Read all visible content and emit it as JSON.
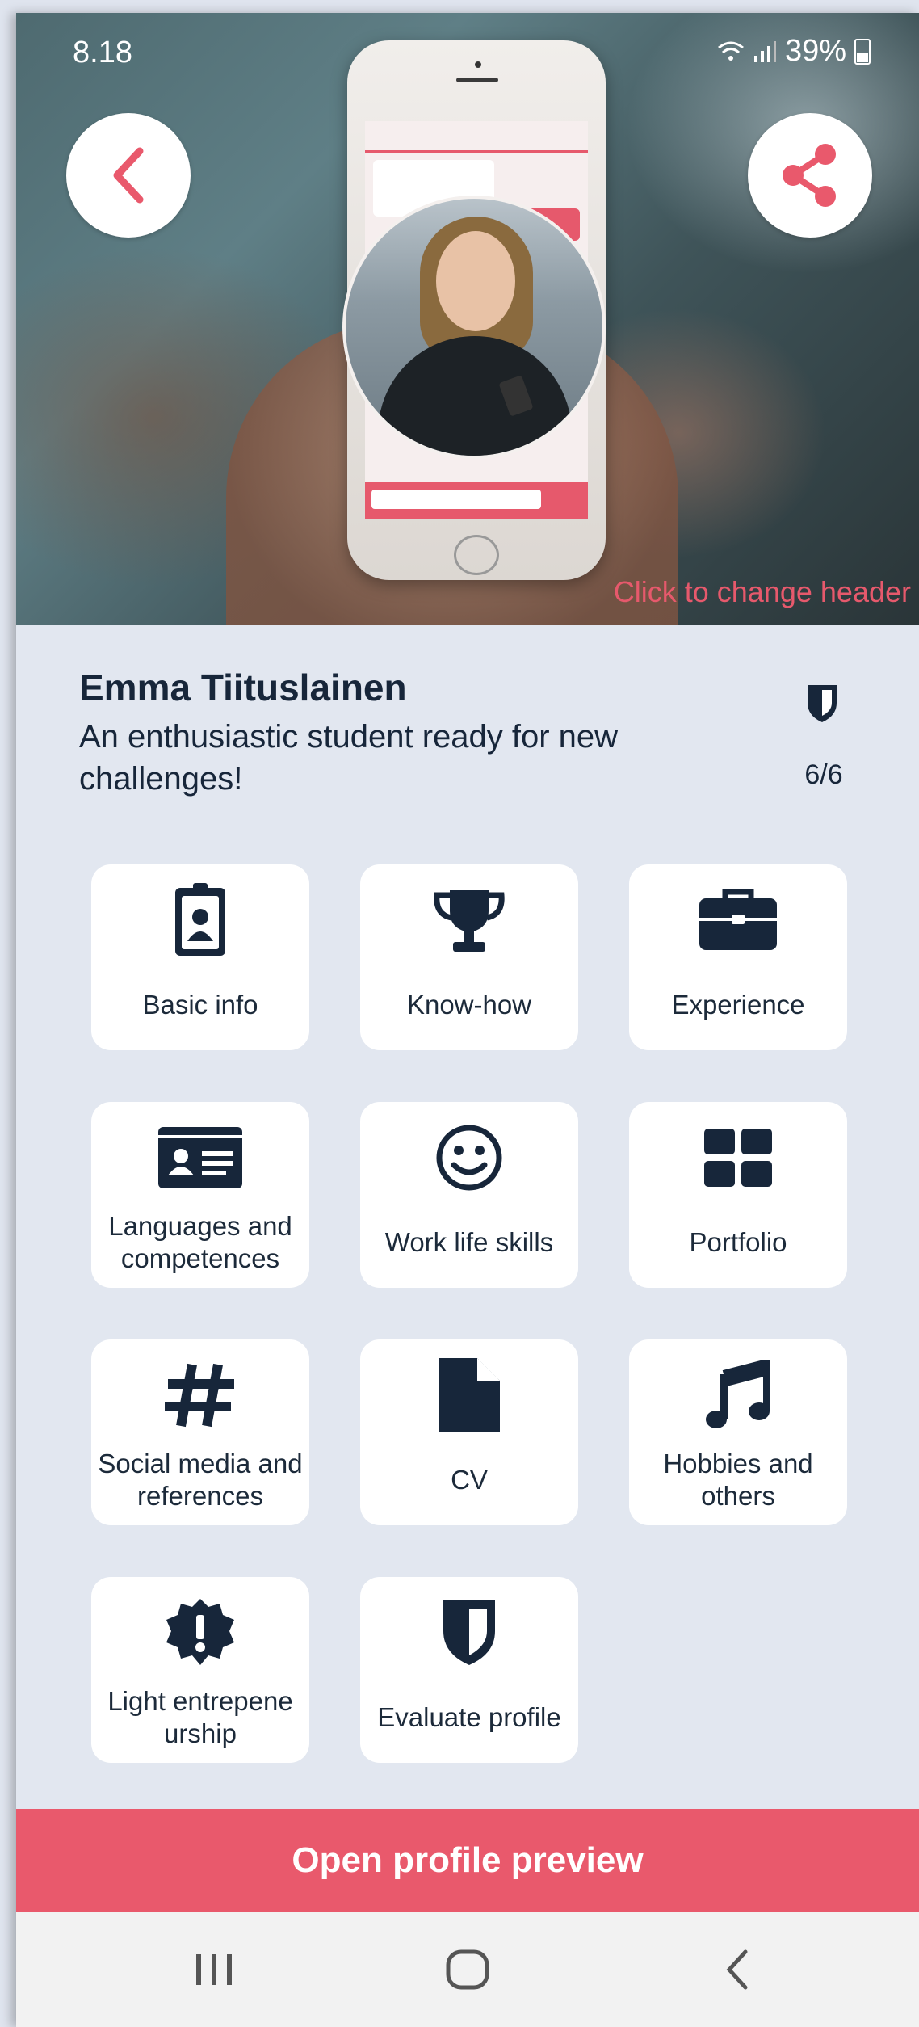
{
  "status_bar": {
    "time": "8.18",
    "battery": "39%"
  },
  "header": {
    "change_header_label": "Click to change header"
  },
  "profile": {
    "name": "Emma Tiituslainen",
    "description": "An enthusiastic student ready for new challenges!",
    "score": "6/6"
  },
  "tiles": [
    {
      "label": "Basic info",
      "icon": "id-badge-icon"
    },
    {
      "label": "Know-how",
      "icon": "trophy-icon"
    },
    {
      "label": "Experience",
      "icon": "briefcase-icon"
    },
    {
      "label": "Languages and competences",
      "icon": "id-card-icon"
    },
    {
      "label": "Work life skills",
      "icon": "smile-icon"
    },
    {
      "label": "Portfolio",
      "icon": "grid-icon"
    },
    {
      "label": "Social media and references",
      "icon": "hashtag-icon"
    },
    {
      "label": "CV",
      "icon": "file-icon"
    },
    {
      "label": "Hobbies and others",
      "icon": "music-icon"
    },
    {
      "label": "Light entrepene urship",
      "icon": "certificate-icon"
    },
    {
      "label": "Evaluate profile",
      "icon": "shield-icon"
    }
  ],
  "preview_button": {
    "label": "Open profile preview"
  },
  "colors": {
    "accent": "#e9596c",
    "navy": "#17263a",
    "background": "#e2e7f0"
  }
}
